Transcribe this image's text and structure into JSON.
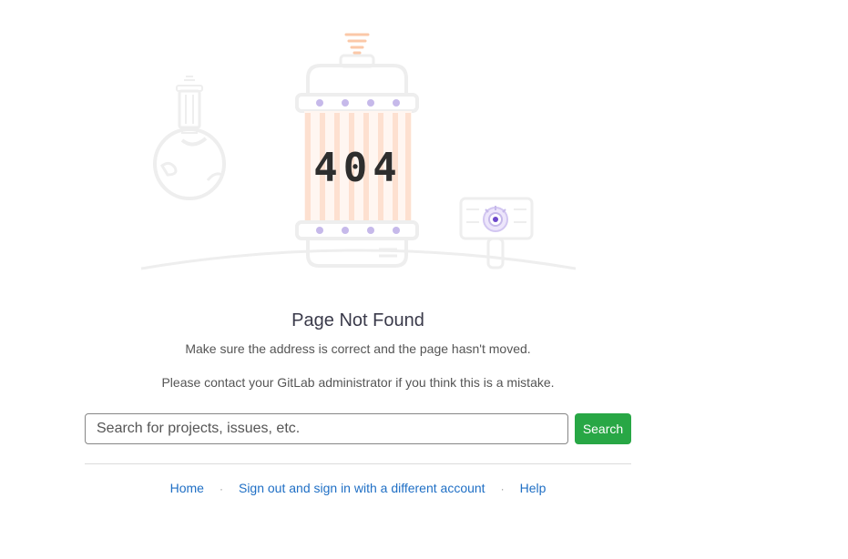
{
  "illustration": {
    "code_text": "404"
  },
  "heading": "Page Not Found",
  "messages": {
    "line1": "Make sure the address is correct and the page hasn't moved.",
    "line2": "Please contact your GitLab administrator if you think this is a mistake."
  },
  "search": {
    "placeholder": "Search for projects, issues, etc.",
    "value": "",
    "button_label": "Search"
  },
  "footer_links": {
    "home": "Home",
    "signout": "Sign out and sign in with a different account",
    "help": "Help",
    "separator": "·"
  },
  "colors": {
    "accent_green": "#28a745",
    "link_blue": "#1f6fc5",
    "illustration_gray": "#eeeeee",
    "illustration_orange": "#fdd9c8",
    "illustration_purple": "#c6b9ea"
  }
}
